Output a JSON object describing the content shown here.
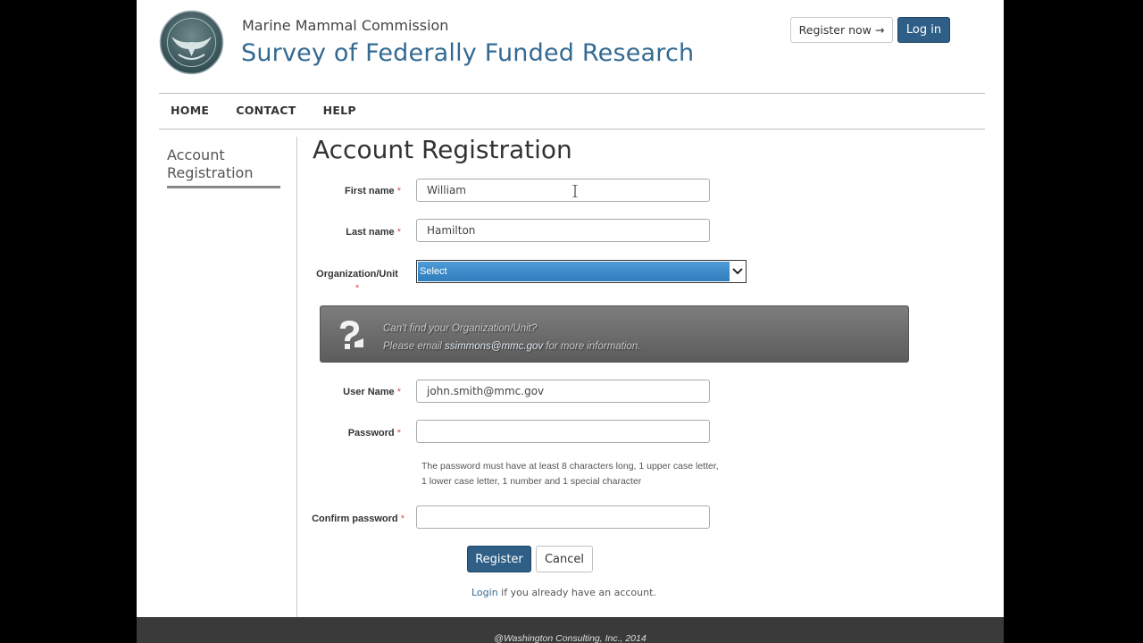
{
  "header": {
    "org_name": "Marine Mammal Commission",
    "site_title": "Survey of Federally Funded Research",
    "register_now_label": "Register now →",
    "login_label": "Log in"
  },
  "nav": {
    "items": [
      "HOME",
      "CONTACT",
      "HELP"
    ]
  },
  "sidebar": {
    "items": [
      {
        "label_line1": "Account",
        "label_line2": "Registration"
      }
    ]
  },
  "form": {
    "heading": "Account Registration",
    "required_mark": "*",
    "first_name": {
      "label": "First name",
      "value": "William"
    },
    "last_name": {
      "label": "Last name",
      "value": "Hamilton"
    },
    "organization": {
      "label": "Organization/Unit",
      "selected": "Select"
    },
    "info": {
      "line1": "Can't find your Organization/Unit?",
      "line2_prefix": "Please email ",
      "line2_link": "ssimmons@mmc.gov",
      "line2_suffix": " for more information."
    },
    "user_name": {
      "label": "User Name",
      "value": "john.smith@mmc.gov"
    },
    "password": {
      "label": "Password",
      "value": ""
    },
    "password_hint_line1": "The password must have at least 8 characters long, 1 upper case letter,",
    "password_hint_line2": "1 lower case letter, 1 number and 1 special character",
    "confirm_password": {
      "label": "Confirm password",
      "value": ""
    },
    "register_label": "Register",
    "cancel_label": "Cancel",
    "login_link": "Login",
    "login_suffix": " if you already have an account."
  },
  "footer": {
    "text": "@Washington Consulting, Inc., 2014"
  },
  "colors": {
    "brand_blue": "#336a93",
    "button_blue": "#2f5f86",
    "required": "#d9534f",
    "footer_bg": "#3a3a3a"
  }
}
